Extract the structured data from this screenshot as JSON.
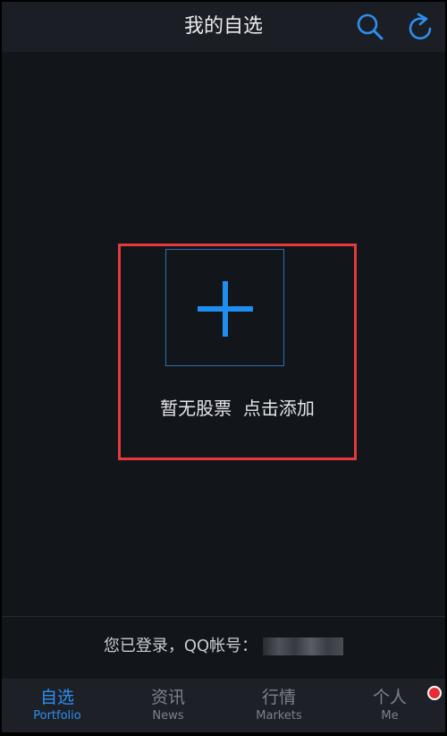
{
  "header": {
    "title": "我的自选",
    "icons": [
      "search-icon",
      "refresh-icon"
    ]
  },
  "empty_state": {
    "message": "暂无股票  点击添加",
    "add_icon": "plus-icon"
  },
  "login": {
    "label": "您已登录，QQ帐号："
  },
  "tabs": [
    {
      "label_cn": "自选",
      "label_en": "Portfolio",
      "active": true
    },
    {
      "label_cn": "资讯",
      "label_en": "News",
      "active": false
    },
    {
      "label_cn": "行情",
      "label_en": "Markets",
      "active": false
    },
    {
      "label_cn": "个人",
      "label_en": "Me",
      "active": false,
      "badge": true
    }
  ],
  "colors": {
    "accent": "#1e8ef0",
    "background": "#12151a",
    "highlight": "#e5393c",
    "badge": "#e62d35"
  }
}
